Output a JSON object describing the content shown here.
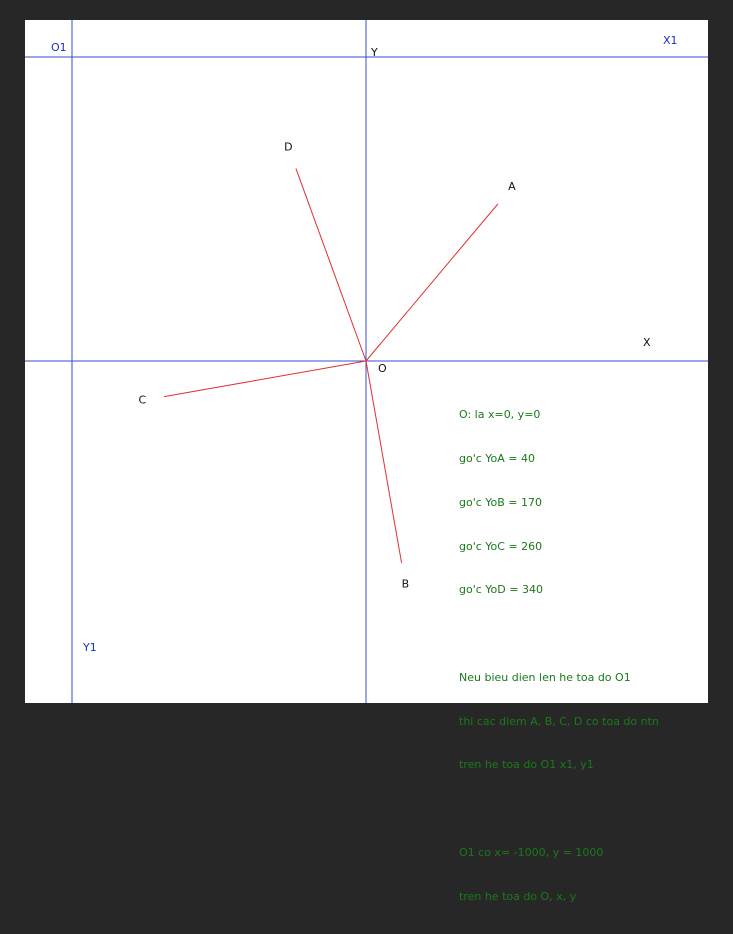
{
  "colors": {
    "frame": "#272727",
    "canvas": "#ffffff",
    "axis": "#3a4fd0",
    "ray": "#e03030",
    "label": "#111111",
    "axis_label": "#1a2fc0",
    "note": "#1a7a1a"
  },
  "axes": {
    "origin_label": "O",
    "x_label": "X",
    "y_label": "Y",
    "origin1_label": "O1",
    "x1_label": "X1",
    "y1_label": "Y1"
  },
  "rays": [
    {
      "label": "A",
      "angle_from_y": 40
    },
    {
      "label": "B",
      "angle_from_y": 170
    },
    {
      "label": "C",
      "angle_from_y": 260
    },
    {
      "label": "D",
      "angle_from_y": 340
    }
  ],
  "notes": [
    "O: la x=0, y=0",
    "go'c YoA = 40",
    "go'c YoB = 170",
    "go'c YoC = 260",
    "go'c YoD = 340",
    "",
    "Neu bieu dien len he toa do O1",
    "thi cac diem A, B, C, D co toa do ntn",
    "tren he toa do O1 x1, y1",
    "",
    "O1 co x= -1000, y = 1000",
    "tren he toa do O, x, y"
  ]
}
